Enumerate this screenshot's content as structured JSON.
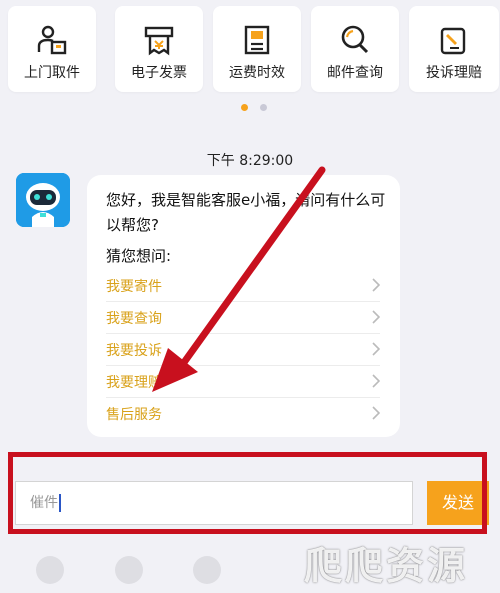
{
  "quick_actions": [
    {
      "label": "上门取件",
      "icon": "courier-pickup-icon"
    },
    {
      "label": "电子发票",
      "icon": "e-invoice-icon"
    },
    {
      "label": "运费时效",
      "icon": "shipping-fee-icon"
    },
    {
      "label": "邮件查询",
      "icon": "search-icon"
    },
    {
      "label": "投诉理赔",
      "icon": "complaint-icon"
    }
  ],
  "pager": {
    "active_color": "#f6a21c",
    "inactive_color": "#c9c9d6"
  },
  "chat": {
    "timestamp": "下午 8:29:00",
    "bot_avatar": "robot-avatar-icon",
    "greeting": "您好，我是智能客服e小福，请问有什么可以帮您?",
    "guess_label": "猜您想问:",
    "suggestions": [
      {
        "label": "我要寄件"
      },
      {
        "label": "我要查询"
      },
      {
        "label": "我要投诉"
      },
      {
        "label": "我要理赔"
      },
      {
        "label": "售后服务"
      }
    ]
  },
  "composer": {
    "input_value": "催件",
    "send_label": "发送"
  },
  "toolbar_icons": [
    "emoji-icon",
    "face-icon",
    "star-icon"
  ],
  "watermark": "爬爬资源",
  "colors": {
    "accent": "#f6a21c",
    "annotation_red": "#c8101e",
    "suggestion": "#d9a21b",
    "avatar_bg": "#1f9be6"
  }
}
